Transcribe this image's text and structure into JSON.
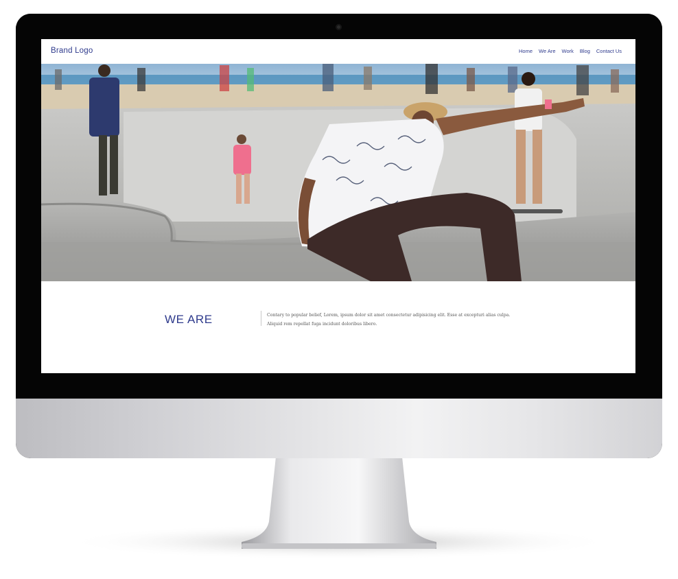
{
  "header": {
    "brand": "Brand Logo",
    "nav": [
      "Home",
      "We Are",
      "Work",
      "Blog",
      "Contact Us"
    ]
  },
  "hero": {
    "image": "skatepark-photo"
  },
  "intro": {
    "heading": "WE ARE",
    "body_line1": "Contary to popular belief, Lorem, ipsum dolor sit amet consectetur adipisicing elit. Esse at excepturi alias culpa.",
    "body_line2": "Aliquid rem repellat fuga incidunt doloribus libero."
  },
  "colors": {
    "accent": "#2e3a8c",
    "bezel": "#050505",
    "chin": "#d8d8db"
  }
}
